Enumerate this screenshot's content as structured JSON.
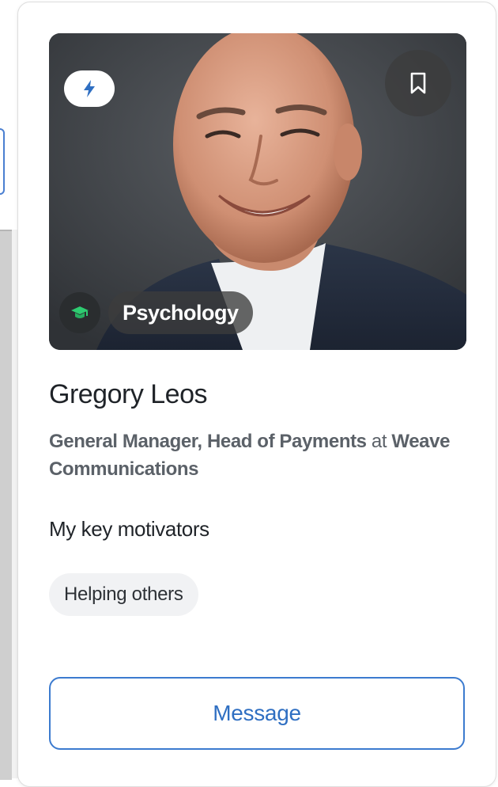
{
  "card": {
    "photo_alt": "Gregory Leos",
    "topic": {
      "label": "Psychology",
      "icon": "graduation-cap-icon",
      "icon_color": "#2ecc71"
    },
    "boost_icon": "lightning-icon",
    "boost_color": "#2f6fc2",
    "bookmark_icon": "bookmark-icon",
    "name": "Gregory Leos",
    "role": {
      "title": "General Manager, Head of Payments",
      "connector": "at",
      "company": "Weave Communications"
    },
    "motivators": {
      "heading": "My key motivators",
      "items": [
        "Helping others"
      ]
    },
    "message_button": "Message"
  },
  "colors": {
    "accent": "#3c7bcf",
    "text_primary": "#1f2328",
    "text_secondary": "#5b6168",
    "chip_bg": "#f1f2f4"
  }
}
